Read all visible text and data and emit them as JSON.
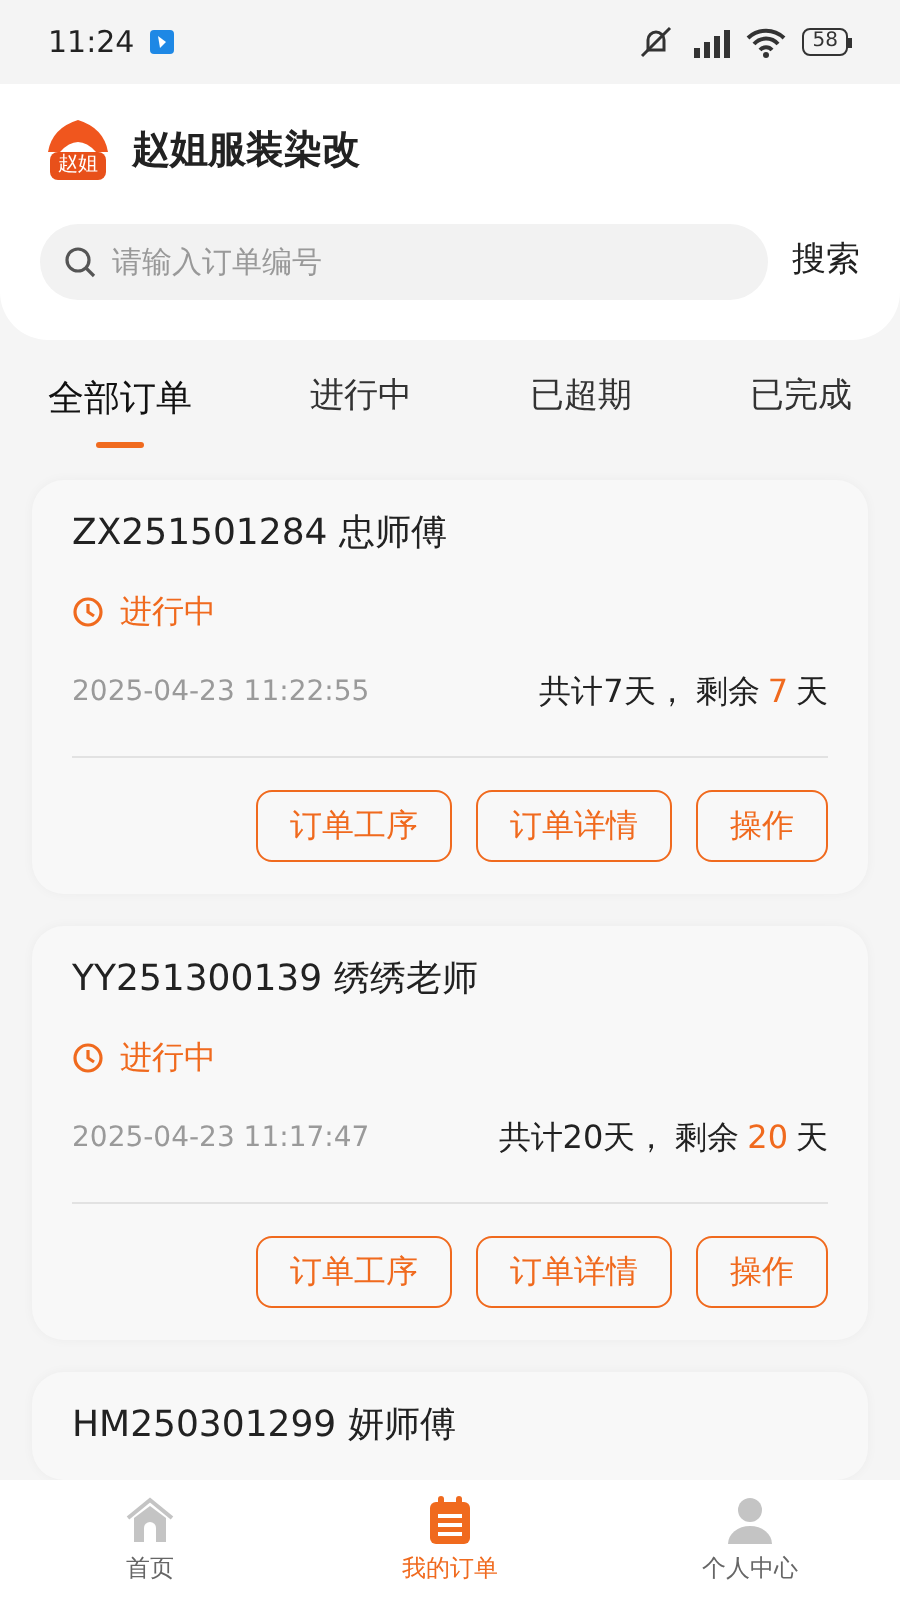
{
  "status_bar": {
    "time": "11:24",
    "battery": "58"
  },
  "header": {
    "logo_text": "赵姐",
    "title": "赵姐服装染改"
  },
  "search": {
    "placeholder": "请输入订单编号",
    "button": "搜索"
  },
  "tabs": [
    {
      "label": "全部订单",
      "selected": true
    },
    {
      "label": "进行中",
      "selected": false
    },
    {
      "label": "已超期",
      "selected": false
    },
    {
      "label": "已完成",
      "selected": false
    }
  ],
  "orders": [
    {
      "title": "ZX251501284 忠师傅",
      "status": "进行中",
      "time": "2025-04-23 11:22:55",
      "total": "共计7天，",
      "remain_label": "剩余",
      "remain": "7",
      "unit": "天",
      "buttons": [
        "订单工序",
        "订单详情",
        "操作"
      ]
    },
    {
      "title": "YY251300139 绣绣老师",
      "status": "进行中",
      "time": "2025-04-23 11:17:47",
      "total": "共计20天，",
      "remain_label": "剩余",
      "remain": "20",
      "unit": "天",
      "buttons": [
        "订单工序",
        "订单详情",
        "操作"
      ]
    },
    {
      "title": "HM250301299 妍师傅"
    }
  ],
  "nav": [
    {
      "label": "首页",
      "kind": "home",
      "selected": false
    },
    {
      "label": "我的订单",
      "kind": "orders",
      "selected": true
    },
    {
      "label": "个人中心",
      "kind": "profile",
      "selected": false
    }
  ]
}
